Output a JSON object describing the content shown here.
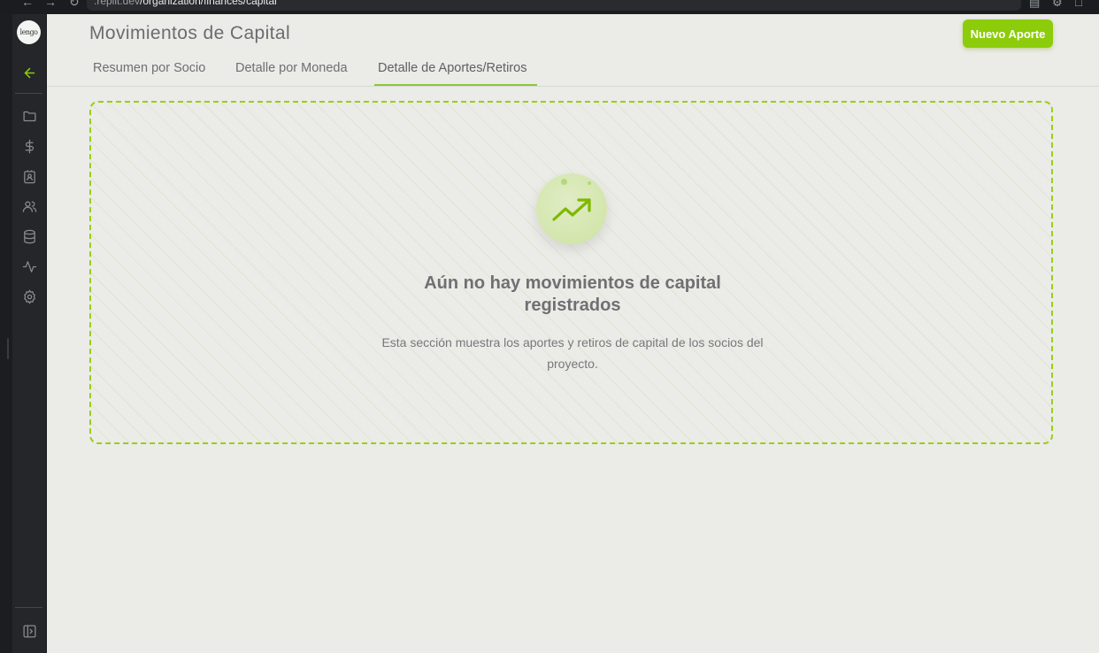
{
  "browser": {
    "url_host": ".replit.dev",
    "url_path": "/organization/finances/capital",
    "back_glyph": "←",
    "forward_glyph": "→",
    "reload_glyph": "↻"
  },
  "sidebar": {
    "logo_text": "lengo",
    "back_icon": "arrow-left-icon",
    "items": [
      {
        "icon": "folder-icon"
      },
      {
        "icon": "dollar-icon"
      },
      {
        "icon": "id-card-icon"
      },
      {
        "icon": "users-icon"
      },
      {
        "icon": "database-icon"
      },
      {
        "icon": "activity-icon"
      },
      {
        "icon": "gear-icon"
      }
    ],
    "bottom_icon": "panel-toggle-icon"
  },
  "header": {
    "title": "Movimientos de Capital",
    "new_button_label": "Nuevo Aporte"
  },
  "tabs": [
    {
      "label": "Resumen por Socio",
      "active": false
    },
    {
      "label": "Detalle por Moneda",
      "active": false
    },
    {
      "label": "Detalle de Aportes/Retiros",
      "active": true
    }
  ],
  "empty_state": {
    "icon": "trending-up-icon",
    "title": "Aún no hay movimientos de capital registrados",
    "description": "Esta sección muestra los aportes y retiros de capital de los socios del proyecto."
  },
  "colors": {
    "accent": "#8ccc0a",
    "tab_underline": "#8cc63f",
    "background": "#ebebe7",
    "sidebar": "#252629"
  }
}
